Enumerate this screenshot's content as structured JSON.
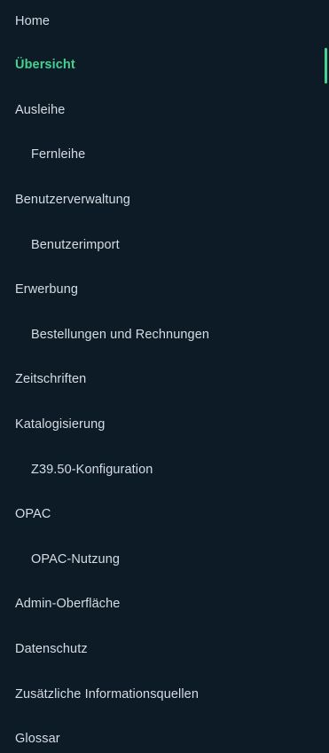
{
  "nav": {
    "items": [
      {
        "label": "Home",
        "level": 0,
        "active": false
      },
      {
        "label": "Übersicht",
        "level": 0,
        "active": true
      },
      {
        "label": "Ausleihe",
        "level": 0,
        "active": false
      },
      {
        "label": "Fernleihe",
        "level": 1,
        "active": false
      },
      {
        "label": "Benutzerverwaltung",
        "level": 0,
        "active": false
      },
      {
        "label": "Benutzerimport",
        "level": 1,
        "active": false
      },
      {
        "label": "Erwerbung",
        "level": 0,
        "active": false
      },
      {
        "label": "Bestellungen und Rechnungen",
        "level": 1,
        "active": false
      },
      {
        "label": "Zeitschriften",
        "level": 0,
        "active": false
      },
      {
        "label": "Katalogisierung",
        "level": 0,
        "active": false
      },
      {
        "label": "Z39.50-Konfiguration",
        "level": 1,
        "active": false
      },
      {
        "label": "OPAC",
        "level": 0,
        "active": false
      },
      {
        "label": "OPAC-Nutzung",
        "level": 1,
        "active": false
      },
      {
        "label": "Admin-Oberfläche",
        "level": 0,
        "active": false
      },
      {
        "label": "Datenschutz",
        "level": 0,
        "active": false
      },
      {
        "label": "Zusätzliche Informationsquellen",
        "level": 0,
        "active": false
      },
      {
        "label": "Glossar",
        "level": 0,
        "active": false
      }
    ]
  },
  "colors": {
    "background": "#0d1b26",
    "text": "#d5dce3",
    "active": "#45d18f"
  }
}
